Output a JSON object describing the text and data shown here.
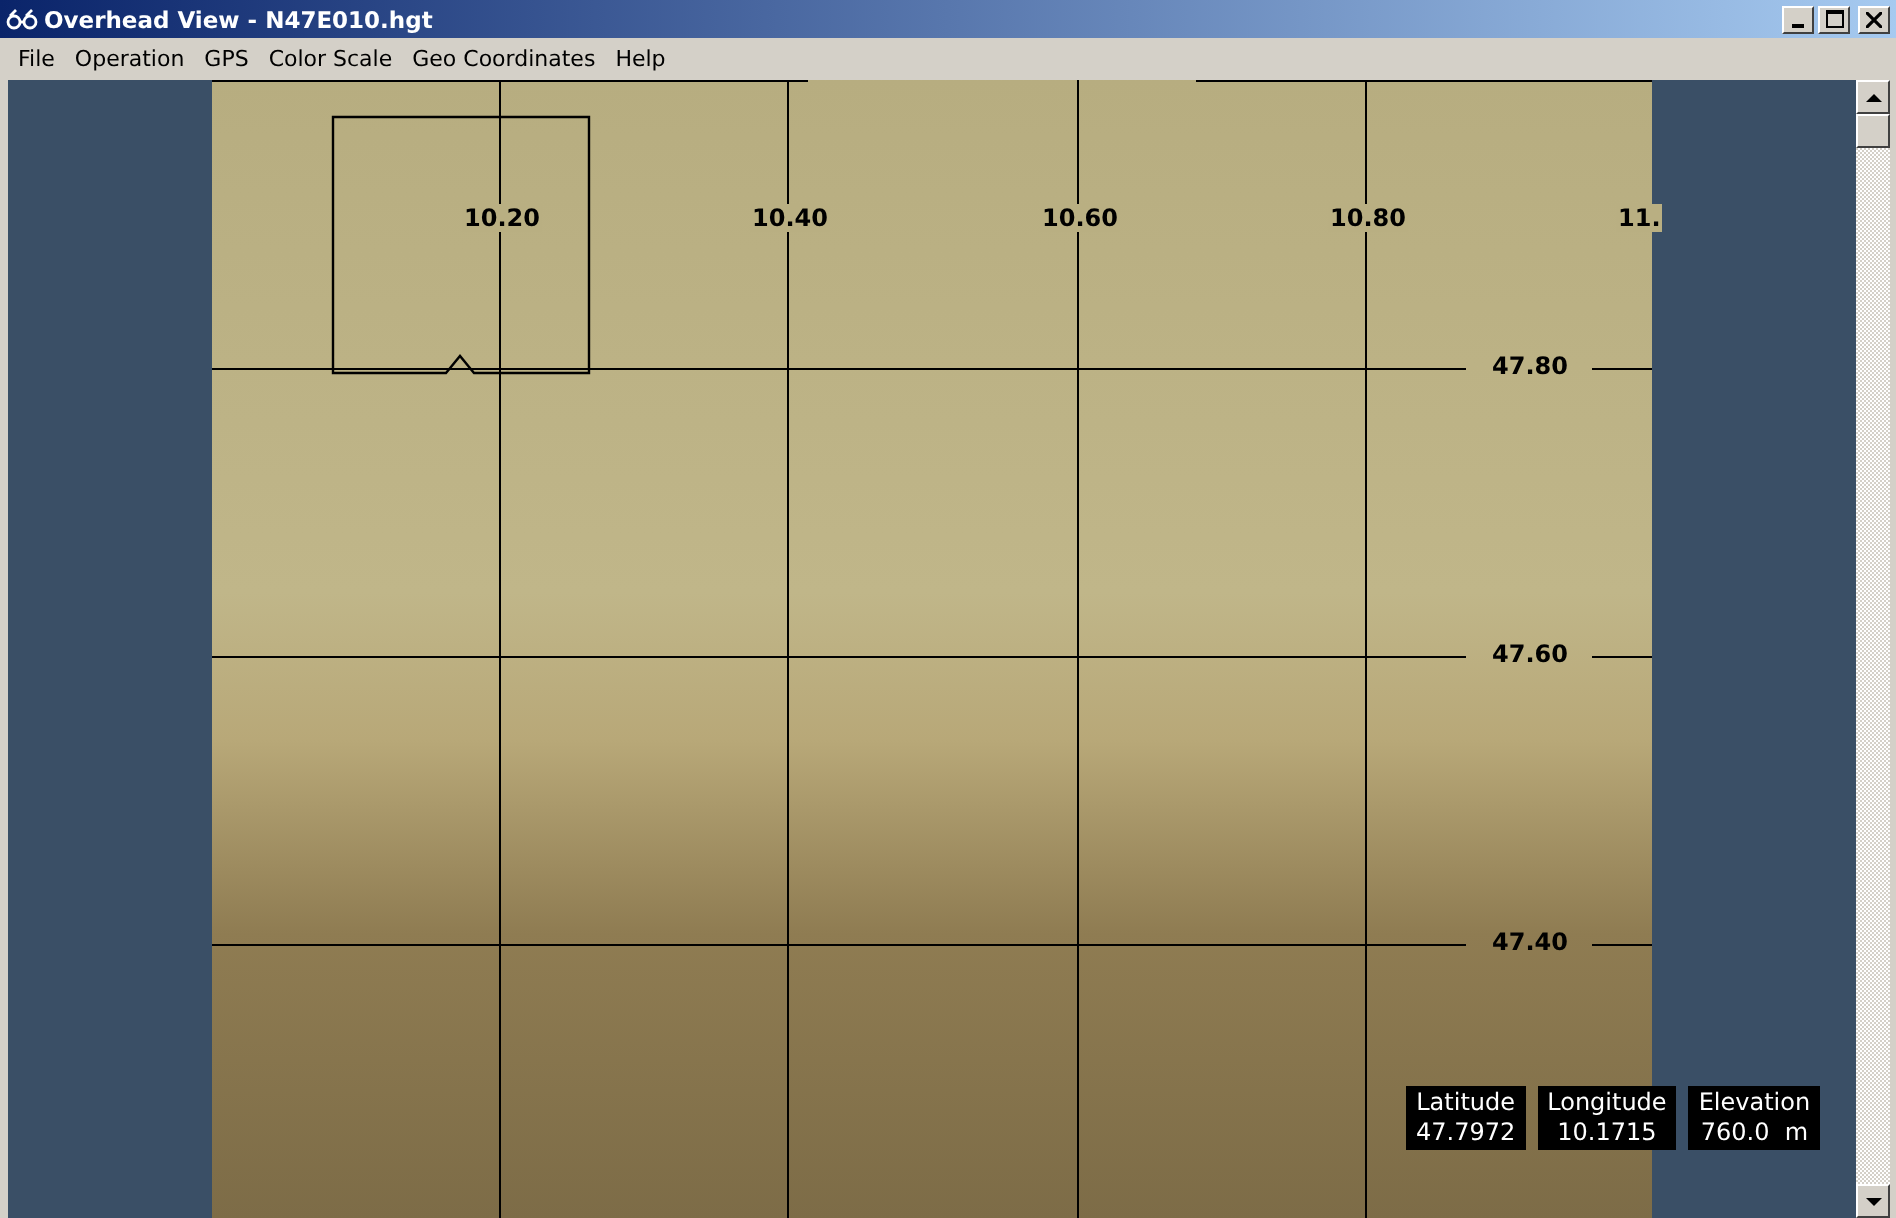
{
  "window": {
    "title": "Overhead View - N47E010.hgt"
  },
  "menu": [
    "File",
    "Operation",
    "GPS",
    "Color Scale",
    "Geo Coordinates",
    "Help"
  ],
  "map": {
    "longitude_labels": [
      "10.20",
      "10.40",
      "10.60",
      "10.80",
      "11."
    ],
    "latitude_labels": [
      "47.80",
      "47.60",
      "47.40"
    ]
  },
  "readouts": [
    {
      "label": "Latitude",
      "value": "47.7972"
    },
    {
      "label": "Longitude",
      "value": "10.1715"
    },
    {
      "label": "Elevation",
      "value": "760.0  m"
    }
  ]
}
